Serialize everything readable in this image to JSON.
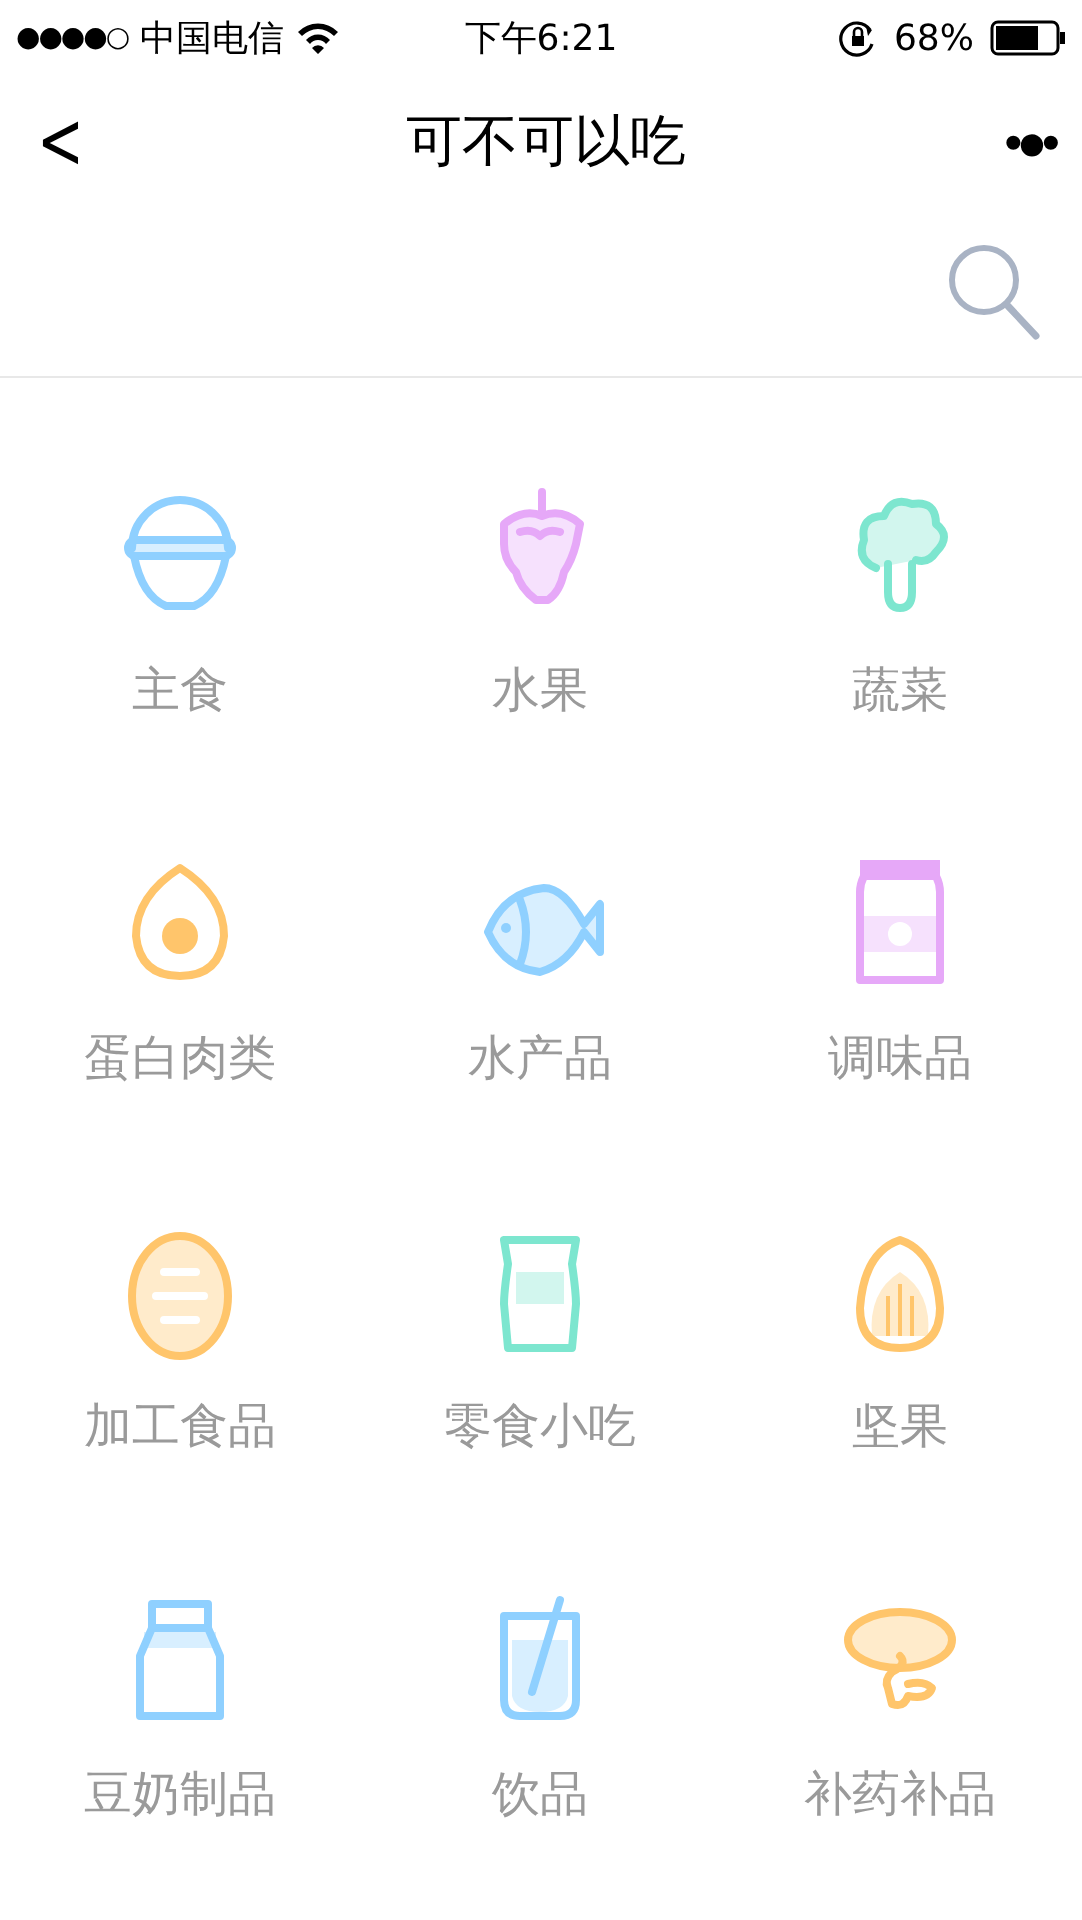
{
  "status_bar": {
    "signal": "●●●●○",
    "carrier": "中国电信",
    "time": "下午6:21",
    "battery": "68%"
  },
  "nav": {
    "back": "<",
    "title": "可不可以吃",
    "more": "•●•"
  },
  "categories": [
    {
      "label": "主食",
      "kind": "bowl",
      "color": "#8fd0ff"
    },
    {
      "label": "水果",
      "kind": "grape",
      "color": "#e6a8f8"
    },
    {
      "label": "蔬菜",
      "kind": "broccoli",
      "color": "#7de6cf"
    },
    {
      "label": "蛋白肉类",
      "kind": "egg",
      "color": "#ffc56b"
    },
    {
      "label": "水产品",
      "kind": "fish",
      "color": "#8fd0ff"
    },
    {
      "label": "调味品",
      "kind": "jar",
      "color": "#e6a8f8"
    },
    {
      "label": "加工食品",
      "kind": "bread",
      "color": "#ffc56b"
    },
    {
      "label": "零食小吃",
      "kind": "snack",
      "color": "#7de6cf"
    },
    {
      "label": "坚果",
      "kind": "nut",
      "color": "#ffc56b"
    },
    {
      "label": "豆奶制品",
      "kind": "carton",
      "color": "#8fd0ff"
    },
    {
      "label": "饮品",
      "kind": "cup",
      "color": "#8fd0ff"
    },
    {
      "label": "补药补品",
      "kind": "mushroom",
      "color": "#ffc56b"
    }
  ]
}
